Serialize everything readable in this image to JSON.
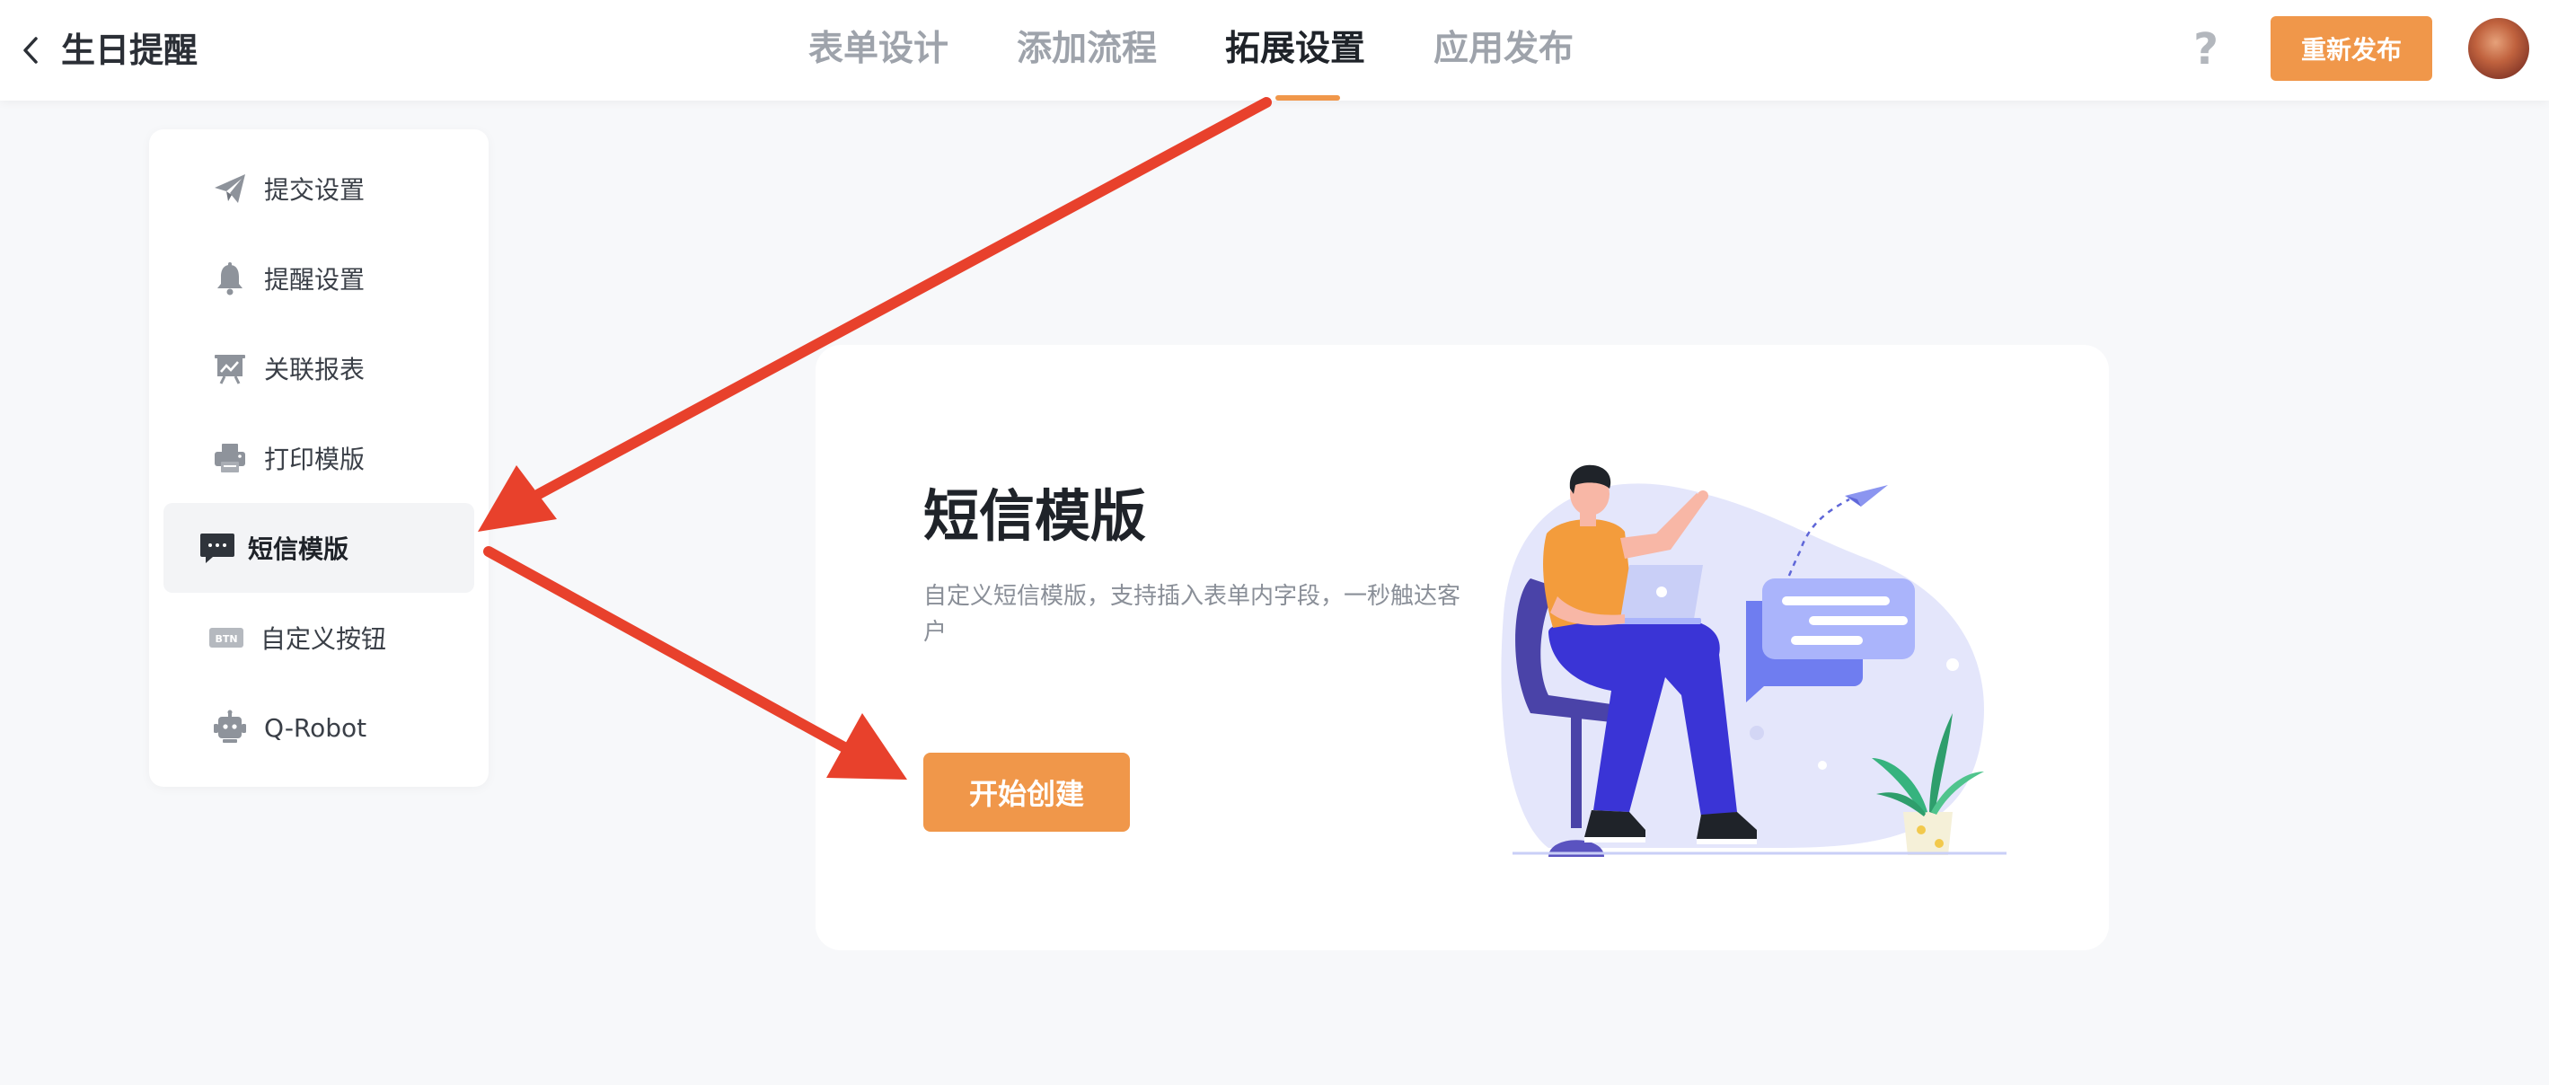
{
  "header": {
    "back_icon": "chevron-left-icon",
    "title": "生日提醒",
    "tabs": [
      {
        "label": "表单设计",
        "active": false
      },
      {
        "label": "添加流程",
        "active": false
      },
      {
        "label": "拓展设置",
        "active": true
      },
      {
        "label": "应用发布",
        "active": false
      }
    ],
    "help_label": "?",
    "publish_label": "重新发布"
  },
  "sidebar": {
    "items": [
      {
        "label": "提交设置",
        "icon": "paper-plane-icon",
        "active": false
      },
      {
        "label": "提醒设置",
        "icon": "bell-icon",
        "active": false
      },
      {
        "label": "关联报表",
        "icon": "report-board-icon",
        "active": false
      },
      {
        "label": "打印模版",
        "icon": "printer-icon",
        "active": false
      },
      {
        "label": "短信模版",
        "icon": "message-bubble-icon",
        "active": true
      },
      {
        "label": "自定义按钮",
        "icon": "btn-badge-icon",
        "icon_text": "BTN",
        "active": false
      },
      {
        "label": "Q-Robot",
        "icon": "robot-icon",
        "active": false
      }
    ]
  },
  "main": {
    "title": "短信模版",
    "description": "自定义短信模版，支持插入表单内字段，一秒触达客户",
    "create_label": "开始创建",
    "illustration": "person-with-laptop-illustration"
  },
  "colors": {
    "accent": "#f0974a",
    "arrow": "#e8412c",
    "illustration_blob": "#e4e6fb",
    "illustration_blue": "#3a34d6"
  }
}
